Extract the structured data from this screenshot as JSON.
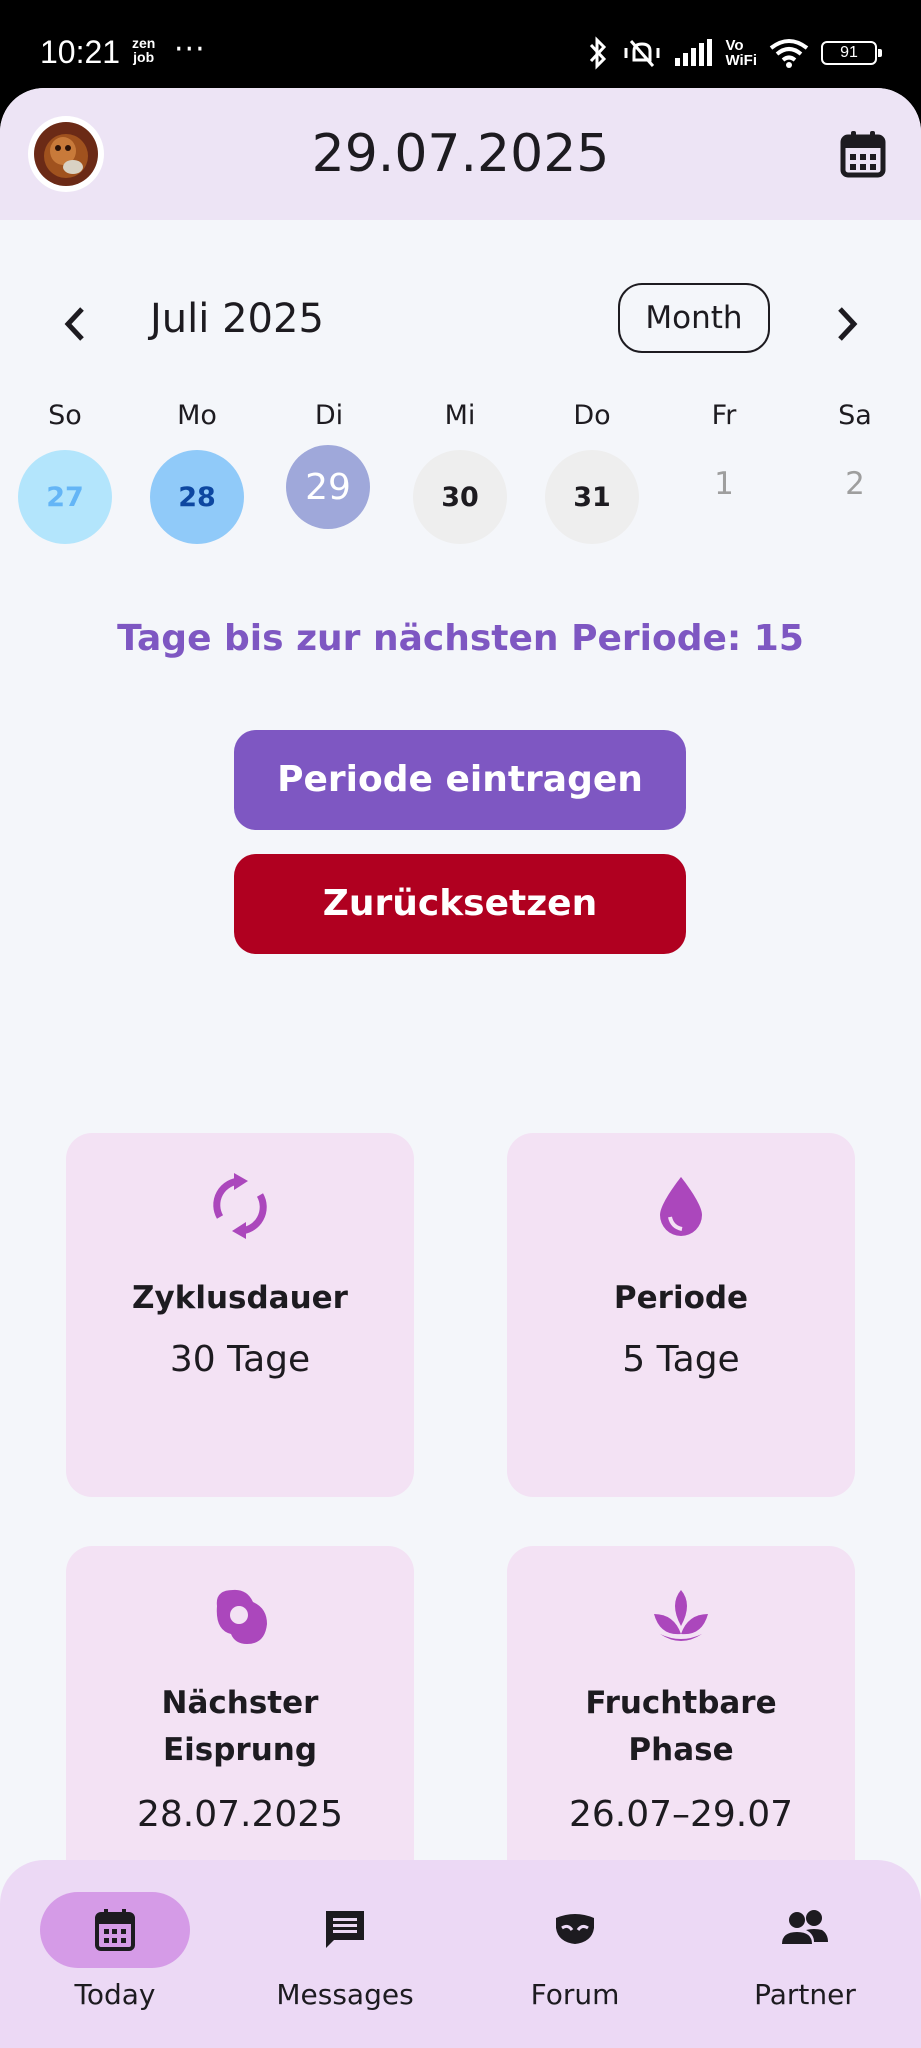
{
  "status_bar": {
    "time": "10:21",
    "app_badge_top": "zen",
    "app_badge_bottom": "job",
    "more": "···",
    "vowifi_top": "Vo",
    "vowifi_bottom": "WiFi",
    "battery": "91"
  },
  "header": {
    "date": "29.07.2025",
    "avatar_icon": "user-avatar",
    "calendar_icon": "calendar-icon"
  },
  "calendar": {
    "month_label": "Juli 2025",
    "view_button": "Month",
    "weekdays": [
      "So",
      "Mo",
      "Di",
      "Mi",
      "Do",
      "Fr",
      "Sa"
    ],
    "days": [
      "27",
      "28",
      "29",
      "30",
      "31",
      "1",
      "2"
    ]
  },
  "countdown_text": "Tage bis zur nächsten Periode: 15",
  "buttons": {
    "log_period": "Periode eintragen",
    "reset": "Zurücksetzen"
  },
  "cards": [
    {
      "icon": "cycle-icon",
      "title": "Zyklusdauer",
      "value": "30 Tage"
    },
    {
      "icon": "drop-icon",
      "title": "Periode",
      "value": "5 Tage"
    },
    {
      "icon": "egg-icon",
      "title_line1": "Nächster",
      "title_line2": "Eisprung",
      "value": "28.07.2025"
    },
    {
      "icon": "lotus-icon",
      "title_line1": "Fruchtbare",
      "title_line2": "Phase",
      "value": "26.07–29.07"
    }
  ],
  "nav": [
    {
      "label": "Today",
      "icon": "calendar-today-icon",
      "active": true
    },
    {
      "label": "Messages",
      "icon": "message-icon",
      "active": false
    },
    {
      "label": "Forum",
      "icon": "mask-icon",
      "active": false
    },
    {
      "label": "Partner",
      "icon": "people-icon",
      "active": false
    }
  ],
  "colors": {
    "accent": "#7e57c2",
    "reset": "#b00020",
    "card_bg": "#f3e2f4",
    "icon_magenta": "#ab47bc",
    "header_bg": "#ede4f5",
    "nav_bg": "#ecd9f5",
    "nav_active": "#d59be7"
  }
}
